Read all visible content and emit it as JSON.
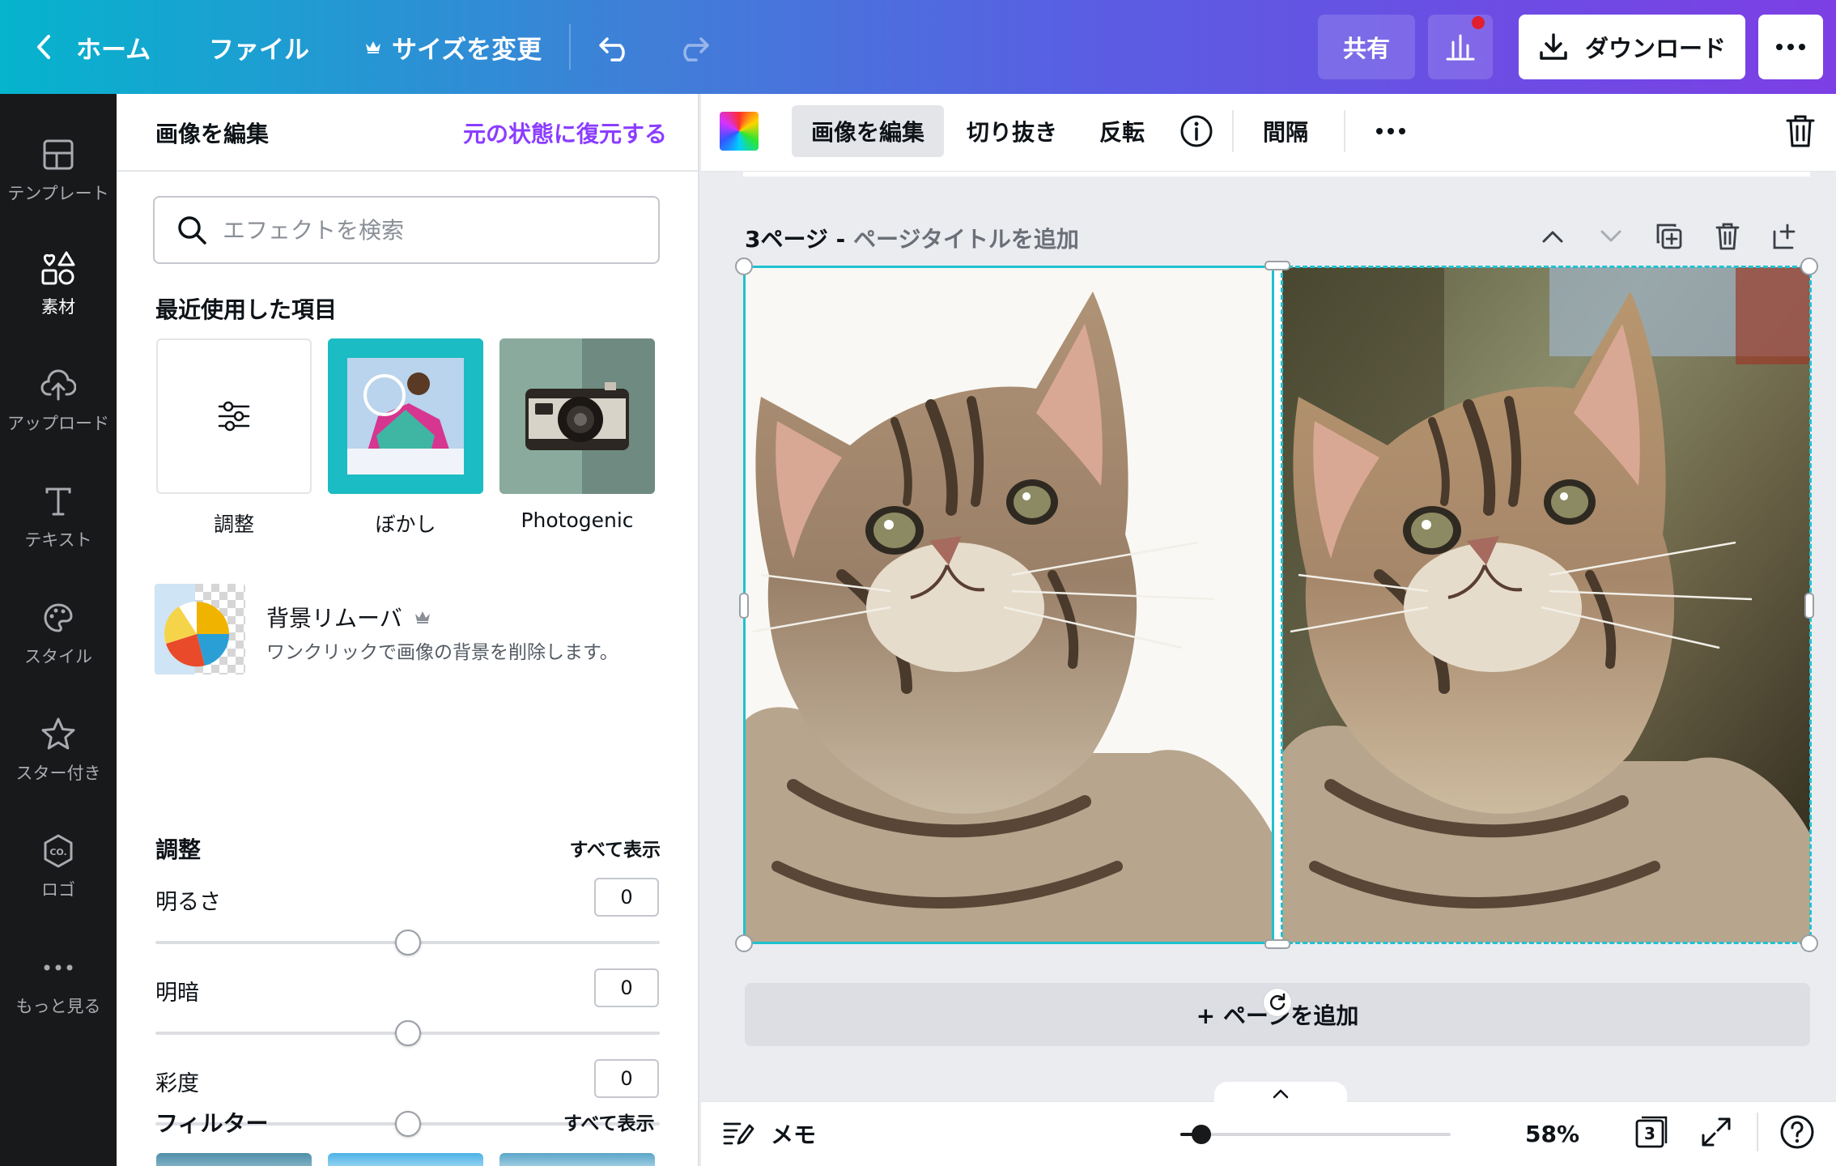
{
  "topbar": {
    "home": "ホーム",
    "file": "ファイル",
    "resize": "サイズを変更",
    "share": "共有",
    "download": "ダウンロード"
  },
  "rail": {
    "items": [
      {
        "label": "テンプレート",
        "icon": "layout-icon"
      },
      {
        "label": "素材",
        "icon": "elements-icon"
      },
      {
        "label": "アップロード",
        "icon": "upload-cloud-icon"
      },
      {
        "label": "テキスト",
        "icon": "text-icon"
      },
      {
        "label": "スタイル",
        "icon": "palette-icon"
      },
      {
        "label": "スター付き",
        "icon": "star-icon"
      },
      {
        "label": "ロゴ",
        "icon": "logo-icon"
      },
      {
        "label": "もっと見る",
        "icon": "more-icon"
      }
    ]
  },
  "panel": {
    "title": "画像を編集",
    "reset": "元の状態に復元する",
    "search_placeholder": "エフェクトを検索",
    "recent_heading": "最近使用した項目",
    "recent": [
      {
        "label": "調整"
      },
      {
        "label": "ぼかし"
      },
      {
        "label": "Photogenic"
      }
    ],
    "bg_remover": {
      "title": "背景リムーバ",
      "desc": "ワンクリックで画像の背景を削除します。"
    },
    "adjust": {
      "heading": "調整",
      "see_all": "すべて表示",
      "sliders": [
        {
          "label": "明るさ",
          "value": "0",
          "level": 0.5
        },
        {
          "label": "明暗",
          "value": "0",
          "level": 0.5
        },
        {
          "label": "彩度",
          "value": "0",
          "level": 0.5
        }
      ]
    },
    "filters": {
      "heading": "フィルター",
      "see_all": "すべて表示"
    }
  },
  "toolbar": {
    "edit_image": "画像を編集",
    "crop": "切り抜き",
    "flip": "反転",
    "spacing": "間隔"
  },
  "canvas": {
    "page_label": "3ページ - ",
    "page_title_placeholder": "ページタイトルを追加",
    "add_page": "+ ページを追加"
  },
  "bottombar": {
    "notes": "メモ",
    "zoom": "58%",
    "zoom_level": 0.58,
    "page_count": "3"
  },
  "colors": {
    "accent": "#8b3dff",
    "selection": "#1ec2d0",
    "rail_bg": "#18191b",
    "notification": "#e0202e"
  }
}
